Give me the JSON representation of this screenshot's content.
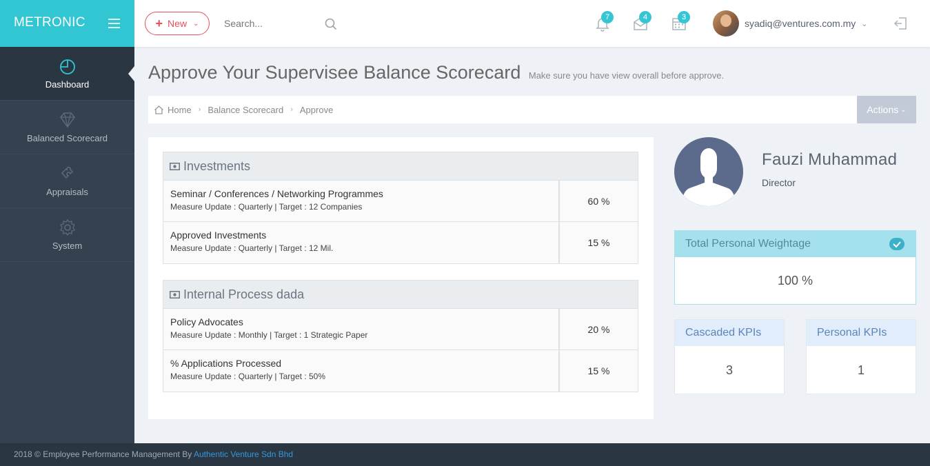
{
  "brand": {
    "name": "METRONIC"
  },
  "header": {
    "new_label": "New",
    "search_placeholder": "Search...",
    "notifications_count": "7",
    "messages_count": "4",
    "tasks_count": "3",
    "user_email": "syadiq@ventures.com.my"
  },
  "sidebar": {
    "items": [
      {
        "label": "Dashboard",
        "icon": "dashboard-icon"
      },
      {
        "label": "Balanced Scorecard",
        "icon": "diamond-icon"
      },
      {
        "label": "Appraisals",
        "icon": "puzzle-icon"
      },
      {
        "label": "System",
        "icon": "gear-icon"
      }
    ]
  },
  "page": {
    "title": "Approve Your Supervisee Balance Scorecard",
    "subtitle": "Make sure you have view overall before approve."
  },
  "breadcrumb": {
    "items": [
      "Home",
      "Balance Scorecard",
      "Approve"
    ],
    "actions_label": "Actions"
  },
  "groups": [
    {
      "title": "Investments",
      "kpis": [
        {
          "name": "Seminar / Conferences / Networking Programmes",
          "meta": "Measure Update : Quarterly | Target : 12 Companies",
          "weight": "60 %"
        },
        {
          "name": "Approved Investments",
          "meta": "Measure Update : Quarterly | Target : 12 Mil.",
          "weight": "15 %"
        }
      ]
    },
    {
      "title": "Internal Process dada",
      "kpis": [
        {
          "name": "Policy Advocates",
          "meta": "Measure Update : Monthly | Target : 1 Strategic Paper",
          "weight": "20 %"
        },
        {
          "name": "% Applications Processed",
          "meta": "Measure Update : Quarterly | Target : 50%",
          "weight": "15 %"
        }
      ]
    }
  ],
  "profile": {
    "name": "Fauzi Muhammad",
    "role": "Director"
  },
  "stats": {
    "weightage_label": "Total Personal Weightage",
    "weightage_value": "100 %",
    "cascaded_label": "Cascaded KPIs",
    "cascaded_value": "3",
    "personal_label": "Personal KPIs",
    "personal_value": "1"
  },
  "footer": {
    "text": "2018 © Employee Performance Management By ",
    "company": "Authentic Venture Sdn Bhd"
  },
  "colors": {
    "brand": "#32c5d2",
    "sidebar": "#364150",
    "danger": "#e7505a",
    "badge": "#36c6d3",
    "link": "#3598dc"
  }
}
